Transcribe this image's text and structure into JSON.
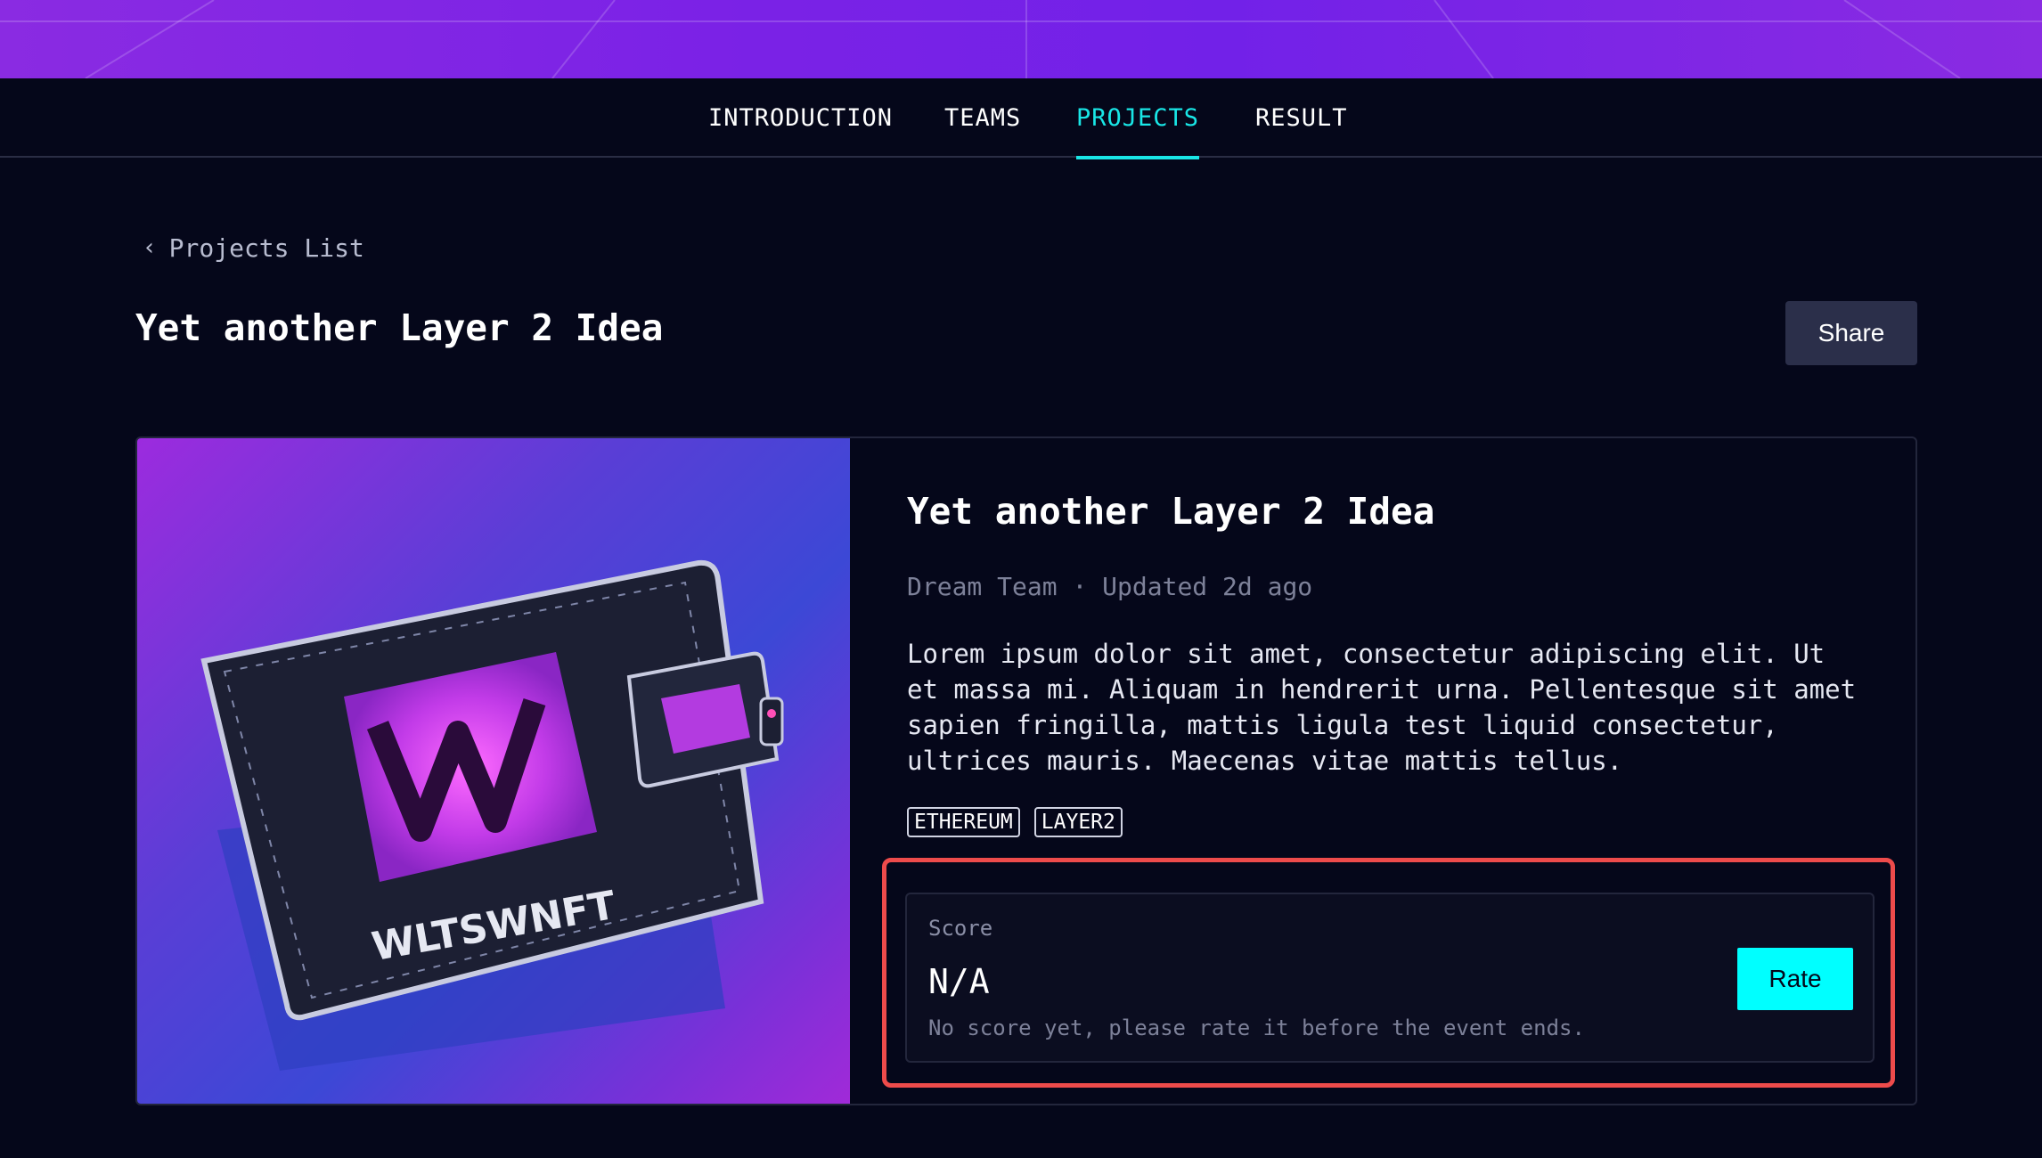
{
  "nav": {
    "items": [
      {
        "label": "INTRODUCTION"
      },
      {
        "label": "TEAMS"
      },
      {
        "label": "PROJECTS"
      },
      {
        "label": "RESULT"
      }
    ],
    "active": "PROJECTS"
  },
  "breadcrumb": {
    "label": "Projects List",
    "icon": "chevron-left-icon"
  },
  "page": {
    "title": "Yet another Layer 2 Idea",
    "share_label": "Share"
  },
  "project": {
    "title": "Yet another Layer 2 Idea",
    "team": "Dream Team",
    "separator": "·",
    "updated": "Updated 2d ago",
    "description": "Lorem ipsum dolor sit amet, consectetur adipiscing elit. Ut et massa mi. Aliquam in hendrerit urna. Pellentesque sit amet sapien fringilla, mattis ligula test liquid consectetur, ultrices mauris. Maecenas vitae mattis tellus.",
    "tags": [
      "ETHEREUM",
      "LAYER2"
    ],
    "image_text": "WLTSWNFT"
  },
  "score": {
    "label": "Score",
    "value": "N/A",
    "note": "No score yet, please rate it before the event ends.",
    "rate_label": "Rate"
  },
  "colors": {
    "background": "#05071a",
    "accent": "#00ffff",
    "active_tab": "#19e6e6",
    "highlight": "#ee4b4b",
    "banner": "#7b22e6"
  }
}
